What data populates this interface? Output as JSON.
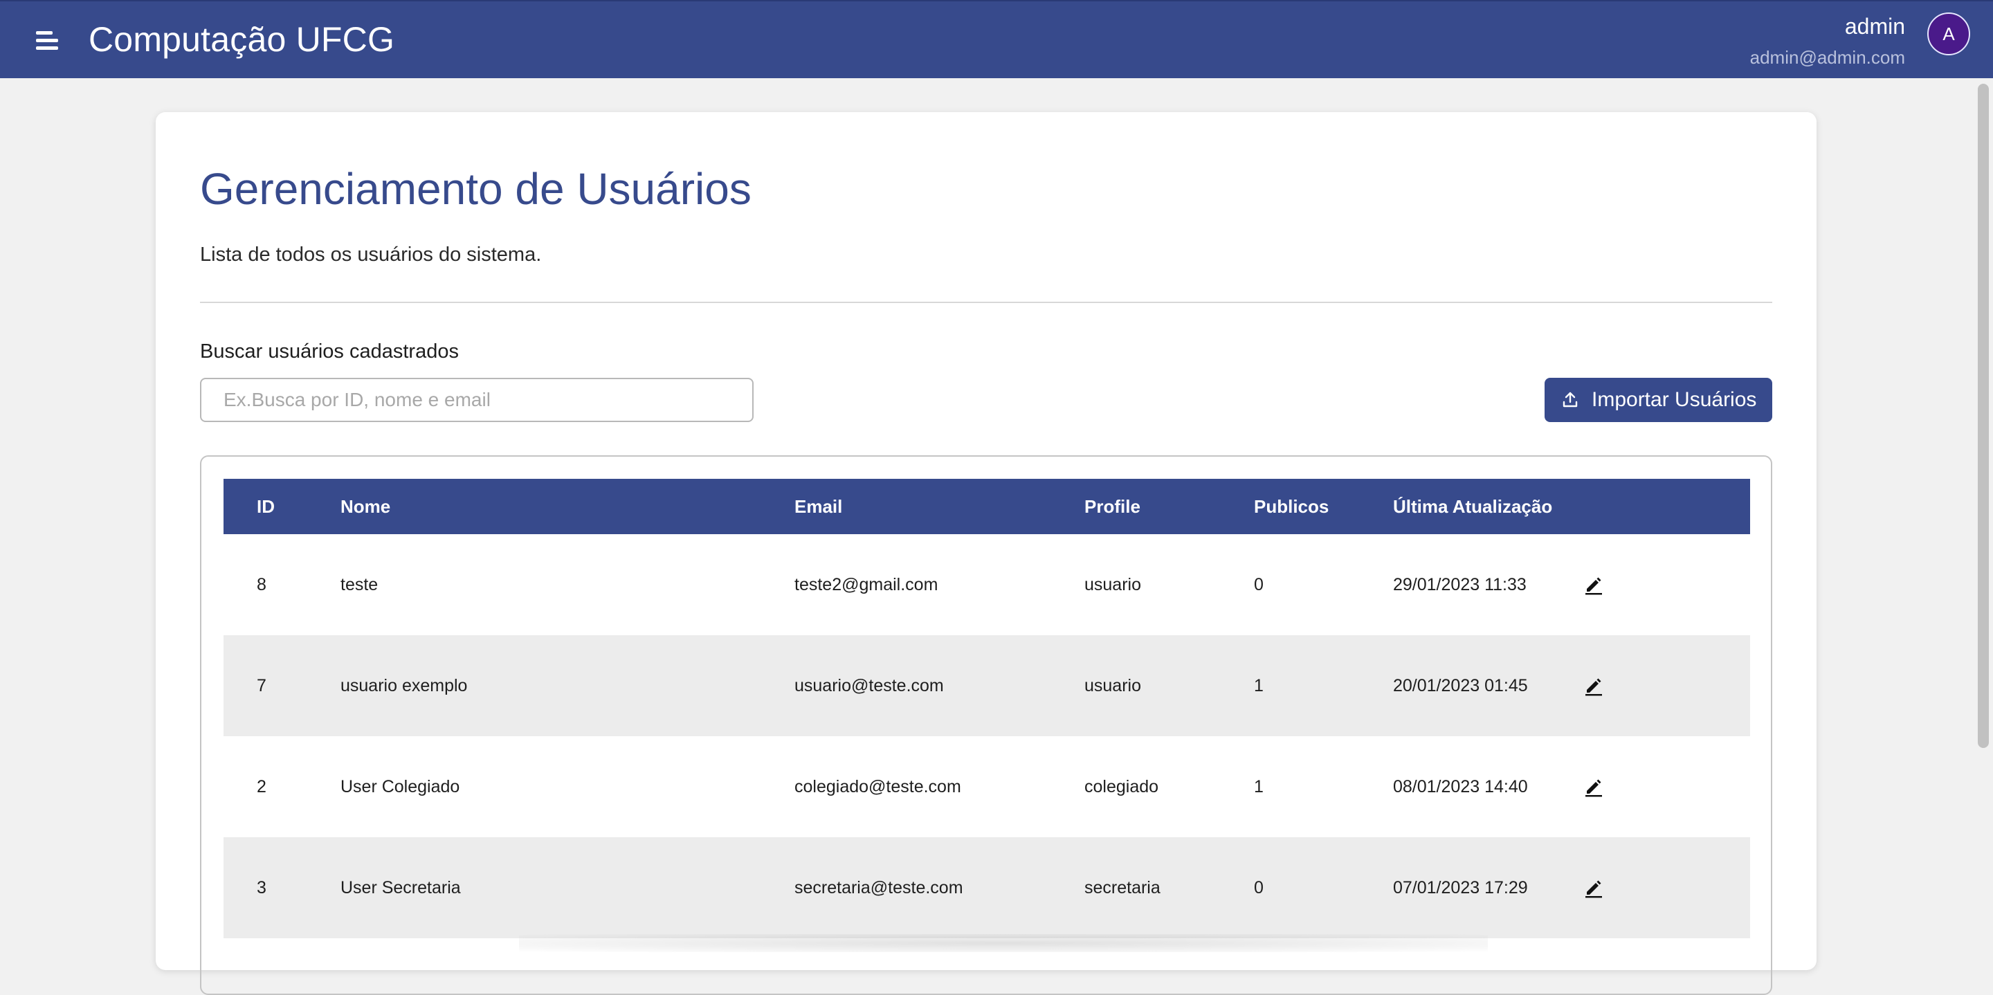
{
  "header": {
    "title": "Computação UFCG",
    "user_name": "admin",
    "user_email": "admin@admin.com",
    "avatar_letter": "A"
  },
  "page": {
    "title": "Gerenciamento de Usuários",
    "subtitle": "Lista de todos os usuários do sistema.",
    "search_label": "Buscar usuários cadastrados",
    "search_placeholder": "Ex.Busca por ID, nome e email",
    "search_value": "",
    "import_button": "Importar Usuários"
  },
  "table": {
    "columns": [
      "ID",
      "Nome",
      "Email",
      "Profile",
      "Publicos",
      "Última Atualização"
    ],
    "rows": [
      {
        "id": "8",
        "nome": "teste",
        "email": "teste2@gmail.com",
        "profile": "usuario",
        "publicos": "0",
        "updated": "29/01/2023 11:33"
      },
      {
        "id": "7",
        "nome": "usuario exemplo",
        "email": "usuario@teste.com",
        "profile": "usuario",
        "publicos": "1",
        "updated": "20/01/2023 01:45"
      },
      {
        "id": "2",
        "nome": "User Colegiado",
        "email": "colegiado@teste.com",
        "profile": "colegiado",
        "publicos": "1",
        "updated": "08/01/2023 14:40"
      },
      {
        "id": "3",
        "nome": "User Secretaria",
        "email": "secretaria@teste.com",
        "profile": "secretaria",
        "publicos": "0",
        "updated": "07/01/2023 17:29"
      }
    ]
  },
  "colors": {
    "primary": "#374a8c",
    "row_alt": "#ececec",
    "avatar": "#4a1a8a"
  },
  "icons": {
    "menu": "menu-icon",
    "upload": "upload-icon",
    "edit": "edit-icon"
  }
}
